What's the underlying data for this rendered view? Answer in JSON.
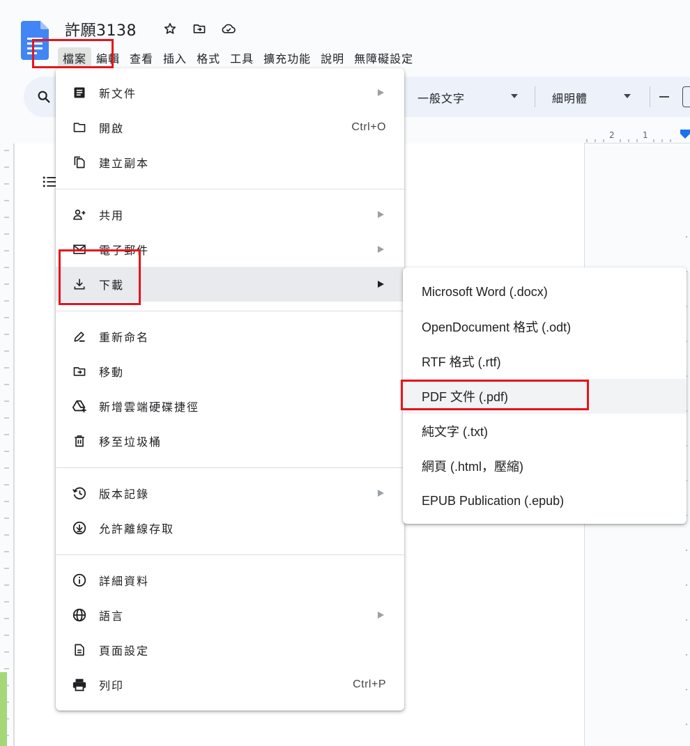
{
  "header": {
    "doc_title": "許願3138",
    "icons": [
      "star-icon",
      "move-folder-icon",
      "cloud-saved-icon"
    ]
  },
  "menubar": [
    "檔案",
    "編輯",
    "查看",
    "插入",
    "格式",
    "工具",
    "擴充功能",
    "說明",
    "無障礙設定"
  ],
  "toolbar": {
    "style_value": "一般文字",
    "font_value": "細明體"
  },
  "ruler": {
    "labels": [
      "2",
      "1"
    ]
  },
  "file_menu": {
    "items": [
      {
        "label": "新文件",
        "icon": "document-icon",
        "arrow": true
      },
      {
        "label": "開啟",
        "icon": "folder-icon",
        "shortcut": "Ctrl+O"
      },
      {
        "label": "建立副本",
        "icon": "copy-icon"
      },
      {
        "label": "共用",
        "icon": "person-add-icon",
        "arrow": true
      },
      {
        "label": "電子郵件",
        "icon": "mail-icon",
        "arrow": true
      },
      {
        "label": "下載",
        "icon": "download-icon",
        "arrow": true,
        "active": true
      },
      {
        "label": "重新命名",
        "icon": "rename-icon"
      },
      {
        "label": "移動",
        "icon": "move-folder-icon"
      },
      {
        "label": "新增雲端硬碟捷徑",
        "icon": "drive-shortcut-icon"
      },
      {
        "label": "移至垃圾桶",
        "icon": "trash-icon"
      },
      {
        "label": "版本記錄",
        "icon": "history-icon",
        "arrow": true
      },
      {
        "label": "允許離線存取",
        "icon": "offline-icon"
      },
      {
        "label": "詳細資料",
        "icon": "info-icon"
      },
      {
        "label": "語言",
        "icon": "globe-icon",
        "arrow": true
      },
      {
        "label": "頁面設定",
        "icon": "page-setup-icon"
      },
      {
        "label": "列印",
        "icon": "print-icon",
        "shortcut": "Ctrl+P"
      }
    ]
  },
  "download_submenu": {
    "items": [
      {
        "label": "Microsoft Word (.docx)"
      },
      {
        "label": "OpenDocument 格式 (.odt)"
      },
      {
        "label": "RTF 格式 (.rtf)"
      },
      {
        "label": "PDF 文件 (.pdf)",
        "active": true
      },
      {
        "label": "純文字 (.txt)"
      },
      {
        "label": "網頁 (.html，壓縮)"
      },
      {
        "label": "EPUB Publication (.epub)"
      }
    ]
  },
  "colors": {
    "highlight": "#e6141b",
    "docs_blue": "#4285f4",
    "menu_hover": "#e8eaed"
  }
}
